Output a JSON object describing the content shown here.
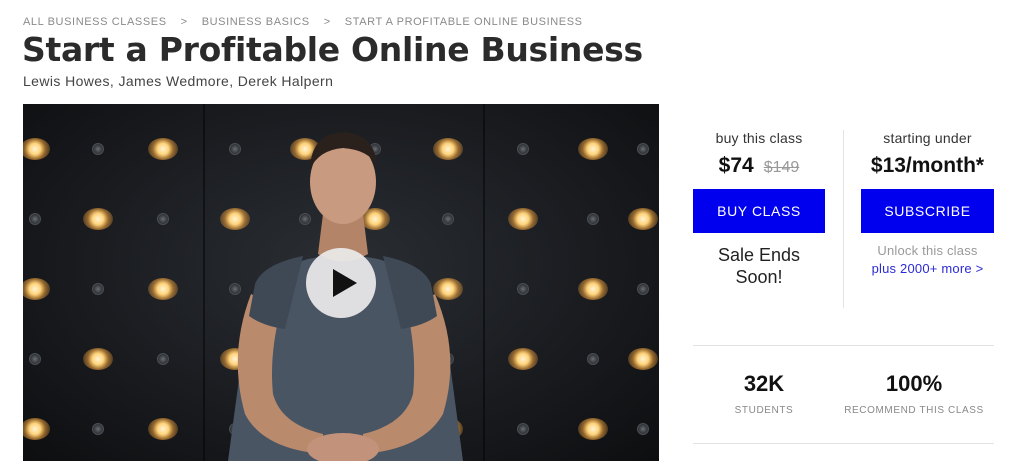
{
  "breadcrumb": {
    "items": [
      "ALL BUSINESS CLASSES",
      "BUSINESS BASICS",
      "START A PROFITABLE ONLINE BUSINESS"
    ],
    "separator": ">"
  },
  "course": {
    "title": "Start a Profitable Online Business",
    "instructors": "Lewis Howes, James Wedmore, Derek Halpern"
  },
  "purchase": {
    "buy_label": "buy this class",
    "price": "$74",
    "original_price": "$149",
    "buy_button": "BUY CLASS",
    "sale_note_line1": "Sale Ends",
    "sale_note_line2": "Soon!",
    "subscribe_label": "starting under",
    "subscribe_price": "$13/month*",
    "subscribe_button": "SUBSCRIBE",
    "unlock_text": "Unlock this class",
    "more_link": "plus 2000+ more >"
  },
  "stats": [
    {
      "value": "32K",
      "caption": "STUDENTS"
    },
    {
      "value": "100%",
      "caption": "RECOMMEND THIS CLASS"
    }
  ],
  "colors": {
    "accent": "#0000ee",
    "link": "#2b2bd6"
  },
  "icons": {
    "play": "play-icon"
  }
}
